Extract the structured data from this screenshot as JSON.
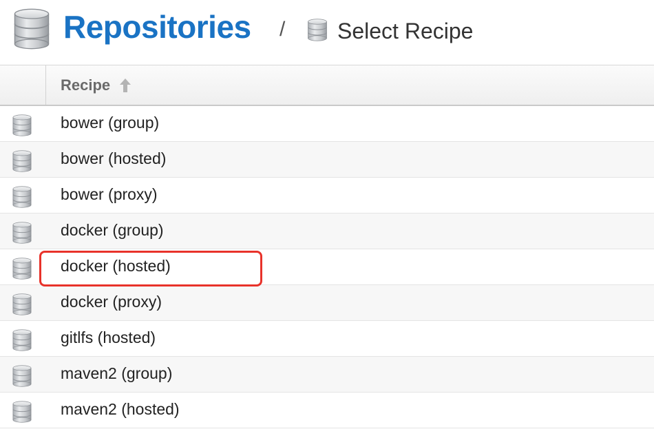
{
  "header": {
    "title": "Repositories",
    "separator": "/",
    "subtitle": "Select Recipe",
    "title_icon": "database-icon",
    "subtitle_icon": "database-icon"
  },
  "table": {
    "column_header": "Recipe",
    "sort_direction": "ascending",
    "sort_icon": "arrow-up-icon",
    "row_icon": "database-icon",
    "rows": [
      {
        "label": "bower (group)"
      },
      {
        "label": "bower (hosted)"
      },
      {
        "label": "bower (proxy)"
      },
      {
        "label": "docker (group)"
      },
      {
        "label": "docker (hosted)",
        "highlighted": true
      },
      {
        "label": "docker (proxy)"
      },
      {
        "label": "gitlfs (hosted)"
      },
      {
        "label": "maven2 (group)"
      },
      {
        "label": "maven2 (hosted)"
      }
    ]
  },
  "colors": {
    "title": "#1a73c4",
    "highlight": "#e8322a",
    "alt_row": "#f7f7f7"
  }
}
